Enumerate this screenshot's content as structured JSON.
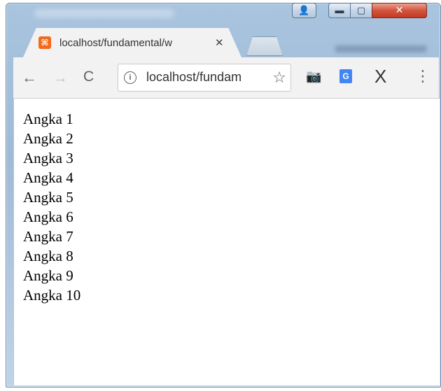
{
  "window": {
    "tab_title": "localhost/fundamental/w",
    "tab_close": "✕",
    "favicon_glyph": "⌘",
    "caption": {
      "user": "👤",
      "minimize": "▬",
      "maximize": "▢",
      "close": "✕"
    }
  },
  "toolbar": {
    "back": "←",
    "forward": "→",
    "reload": "C",
    "info": "i",
    "url": "localhost/fundam",
    "bookmark": "☆",
    "camera": "📷",
    "translate": "G",
    "extension_x": "X",
    "menu": "⋮"
  },
  "content": {
    "items": [
      "Angka 1",
      "Angka 2",
      "Angka 3",
      "Angka 4",
      "Angka 5",
      "Angka 6",
      "Angka 7",
      "Angka 8",
      "Angka 9",
      "Angka 10"
    ]
  }
}
